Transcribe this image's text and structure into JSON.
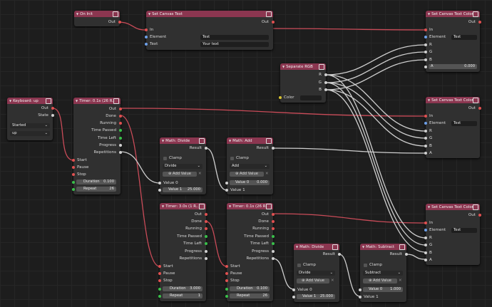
{
  "on_init": {
    "title": "On Init",
    "out": "Out"
  },
  "set_text": {
    "title": "Set Canvas Text",
    "out": "Out",
    "in": "In",
    "element_label": "Element",
    "element_value": "Test",
    "text_label": "Text",
    "text_value": "Your text"
  },
  "color1": {
    "title": "Set Canvas Text Color",
    "out": "Out",
    "in": "In",
    "element_label": "Element",
    "element_value": "Test",
    "r": "R",
    "g": "G",
    "b": "B",
    "a_label": "A",
    "a_value": "0.000"
  },
  "sep_rgb": {
    "title": "Separate RGB",
    "r": "R",
    "g": "G",
    "b": "B",
    "color": "Color"
  },
  "keyboard": {
    "title": "Keyboard: up",
    "out": "Out",
    "state": "State",
    "event_value": "Started",
    "key_value": "up"
  },
  "timer1": {
    "title": "Timer: 0.1s (26 R..",
    "out": "Out",
    "done": "Done",
    "running": "Running",
    "time_passed": "Time Passed",
    "time_left": "Time Left",
    "progress": "Progress",
    "repetitions": "Repetitions",
    "start": "Start",
    "pause": "Pause",
    "stop": "Stop",
    "duration_label": "Duration",
    "duration_value": "0.100",
    "repeat_label": "Repeat",
    "repeat_value": "26"
  },
  "color2": {
    "title": "Set Canvas Text Color",
    "out": "Out",
    "in": "In",
    "element_label": "Element",
    "element_value": "Test",
    "r": "R",
    "g": "G",
    "b": "B",
    "a": "A"
  },
  "divide1": {
    "title": "Math: Divide",
    "result": "Result",
    "clamp": "Clamp",
    "op": "Divide",
    "add_value": "Add Value",
    "value0": "Value 0",
    "value1_label": "Value 1",
    "value1_value": "25.000"
  },
  "add1": {
    "title": "Math: Add",
    "result": "Result",
    "clamp": "Clamp",
    "op": "Add",
    "add_value": "Add Value",
    "value0_label": "Value 0",
    "value0_value": "0.000",
    "value1": "Value 1"
  },
  "timer2": {
    "title": "Timer: 3.0s (1 R..)",
    "out": "Out",
    "done": "Done",
    "running": "Running",
    "time_passed": "Time Passed",
    "time_left": "Time Left",
    "progress": "Progress",
    "repetitions": "Repetitions",
    "start": "Start",
    "pause": "Pause",
    "stop": "Stop",
    "duration_label": "Duration",
    "duration_value": "3.000",
    "repeat_label": "Repeat",
    "repeat_value": "1"
  },
  "timer3": {
    "title": "Timer: 0.1s (26 R..",
    "out": "Out",
    "done": "Done",
    "running": "Running",
    "time_passed": "Time Passed",
    "time_left": "Time Left",
    "progress": "Progress",
    "repetitions": "Repetitions",
    "start": "Start",
    "pause": "Pause",
    "stop": "Stop",
    "duration_label": "Duration",
    "duration_value": "0.100",
    "repeat_label": "Repeat",
    "repeat_value": "26"
  },
  "divide2": {
    "title": "Math: Divide",
    "result": "Result",
    "clamp": "Clamp",
    "op": "Divide",
    "add_value": "Add Value",
    "value0": "Value 0",
    "value1_label": "Value 1",
    "value1_value": "25.000"
  },
  "subtract": {
    "title": "Math: Subtract",
    "result": "Result",
    "clamp": "Clamp",
    "op": "Subtract",
    "add_value": "Add Value",
    "value0_label": "Value 0",
    "value0_value": "1.000",
    "value1": "Value 1"
  },
  "color3": {
    "title": "Set Canvas Text Color",
    "out": "Out",
    "in": "In",
    "element_label": "Element",
    "element_value": "Test",
    "r": "R",
    "g": "G",
    "b": "B",
    "a": "A"
  },
  "colors": {
    "header": "#8b3650",
    "node": "#303030",
    "wire_red": "#e05050",
    "wire_white": "#cfcfcf",
    "bg": "#1d1d1d"
  }
}
